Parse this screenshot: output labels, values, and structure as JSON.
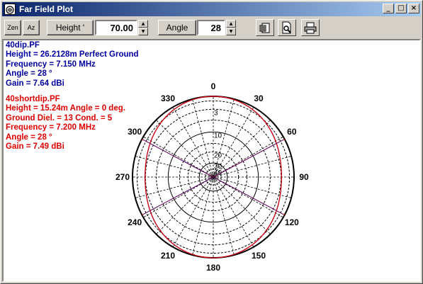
{
  "window": {
    "title": "Far Field Plot",
    "app_icon": "farfield-app-icon",
    "controls": {
      "minimize": "_",
      "maximize": "□",
      "close": "×"
    }
  },
  "toolbar": {
    "zen_label": "Zen",
    "az_label": "Az",
    "height_label": "Height '",
    "height_value": "70.00",
    "angle_label": "Angle",
    "angle_value": "28",
    "icons": [
      "properties-icon",
      "print-preview-icon",
      "print-icon"
    ]
  },
  "series": [
    {
      "color": "#0000a0",
      "lines": [
        "40dip.PF",
        "Height =  26.2128m Perfect Ground",
        "Frequency = 7.150 MHz",
        "Angle = 28 °",
        "Gain = 7.64 dBi"
      ]
    },
    {
      "color": "#e00000",
      "lines": [
        "40shortdip.PF",
        "Height =  15.24m Angle =  0 deg.",
        "Ground Diel. =  13  Cond. =  5",
        "Frequency = 7.200 MHz",
        "Angle = 28 °",
        "Gain = 7.49 dBi"
      ]
    }
  ],
  "chart_data": {
    "type": "polar",
    "angle_labels": [
      "0",
      "30",
      "60",
      "90",
      "120",
      "150",
      "180",
      "210",
      "240",
      "270",
      "300",
      "330"
    ],
    "radial_labels": [
      "3",
      "10",
      "20",
      "30",
      "40"
    ],
    "radial_values_db": [
      -3,
      -10,
      -20,
      -30,
      -40
    ],
    "grid": true,
    "series_colors": [
      "#0000a0",
      "#e00000"
    ]
  }
}
